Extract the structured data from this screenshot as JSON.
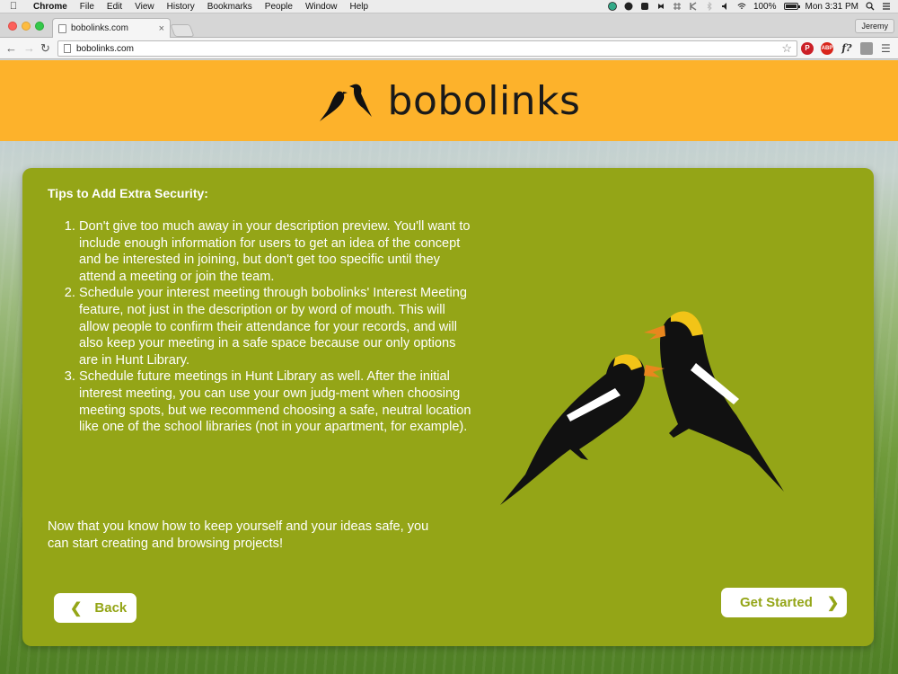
{
  "menubar": {
    "app": "Chrome",
    "items": [
      "File",
      "Edit",
      "View",
      "History",
      "Bookmarks",
      "People",
      "Window",
      "Help"
    ],
    "battery_text": "100%",
    "battery_level": 1.0,
    "clock": "Mon 3:31 PM"
  },
  "browser": {
    "tab_title": "bobolinks.com",
    "tab_close": "×",
    "url": "bobolinks.com",
    "profile": "Jeremy",
    "extensions": [
      "pinterest-icon",
      "adblock-icon",
      "formula-icon",
      "layers-icon"
    ],
    "adblock_label": "ABP",
    "fx_label": "f?"
  },
  "site": {
    "brand": "bobolinks",
    "card_title": "Tips to Add Extra Security:",
    "tips": [
      "Don't give too much away in your description preview. You'll want to include enough information for users to get an idea of the concept and be interested in joining, but don't get too specific until they attend a meeting or join the team.",
      "Schedule your interest meeting through bobolinks' Interest Meeting feature, not just in the description or by word of mouth. This will allow people to confirm their attendance for your records, and will also keep your meeting in a safe space because our only options are in Hunt Library.",
      "Schedule future meetings in Hunt Library as well. After the initial interest meeting, you can use your own judg-ment when choosing meeting spots, but we recommend choosing a safe, neutral location like one of the school libraries (not in your apartment, for example)."
    ],
    "closing": "Now that you know how to keep yourself and your ideas safe, you can start creating and browsing projects!",
    "back_label": "Back",
    "start_label": "Get Started"
  },
  "colors": {
    "header": "#fdb22b",
    "card": "#94a517",
    "bird_black": "#111111",
    "bird_yellow": "#f2c417",
    "bird_beak": "#e8871e"
  }
}
